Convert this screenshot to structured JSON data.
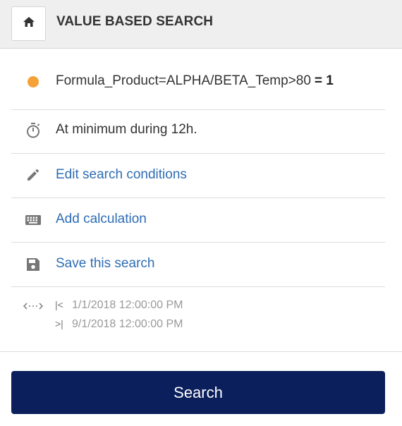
{
  "header": {
    "title": "VALUE BASED SEARCH",
    "home_icon": "home-icon"
  },
  "condition": {
    "formula": "Formula_Product=ALPHA/BETA_Temp>80",
    "value": "= 1",
    "dot_color": "#f5a13a"
  },
  "duration": {
    "text": "At minimum during 12h.",
    "icon": "stopwatch-icon"
  },
  "actions": {
    "edit": "Edit search conditions",
    "add_calc": "Add calculation",
    "save": "Save this search"
  },
  "range": {
    "icon": "range-icon",
    "start": "1/1/2018 12:00:00 PM",
    "end": "9/1/2018 12:00:00 PM"
  },
  "search_button": {
    "label": "Search",
    "color": "#0b1f5c"
  },
  "colors": {
    "link": "#2e6db4",
    "header_bg": "#efefef"
  }
}
